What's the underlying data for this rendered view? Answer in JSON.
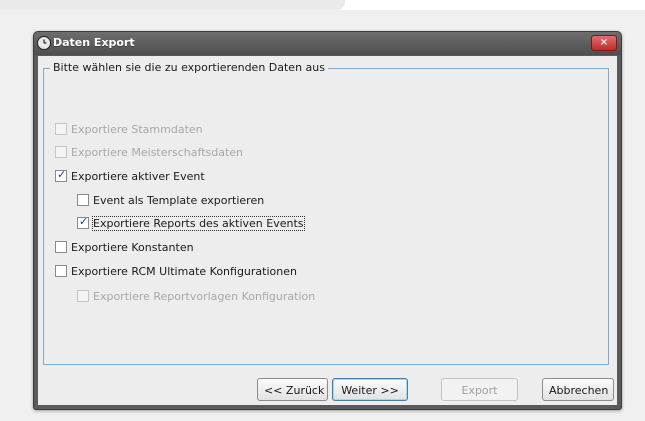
{
  "window": {
    "title": "Daten Export",
    "close_glyph": "×"
  },
  "group": {
    "legend": "Bitte wählen sie die zu exportierenden Daten aus"
  },
  "options": [
    {
      "label": "Exportiere Stammdaten",
      "checked": false,
      "enabled": false
    },
    {
      "label": "Exportiere Meisterschaftsdaten",
      "checked": false,
      "enabled": false
    },
    {
      "label": "Exportiere aktiver Event",
      "checked": true,
      "enabled": true
    },
    {
      "label": "Event als Template exportieren",
      "checked": false,
      "enabled": true
    },
    {
      "label": "Exportiere Reports des aktiven Events",
      "checked": true,
      "enabled": true,
      "focused": true
    },
    {
      "label": "Exportiere Konstanten",
      "checked": false,
      "enabled": true
    },
    {
      "label": "Exportiere RCM Ultimate Konfigurationen",
      "checked": false,
      "enabled": true
    },
    {
      "label": "Exportiere Reportvorlagen Konfiguration",
      "checked": false,
      "enabled": false
    }
  ],
  "check_glyph": "✓",
  "buttons": {
    "back": "<< Zurück",
    "next": "Weiter >>",
    "export": "Export",
    "cancel": "Abbrechen"
  },
  "icons": {
    "window_icon": "clock-icon",
    "close_icon": "close-icon"
  },
  "colors": {
    "group_border": "#7faad8",
    "close_button": "#d13a3a",
    "default_button_border": "#3c7fb1"
  }
}
